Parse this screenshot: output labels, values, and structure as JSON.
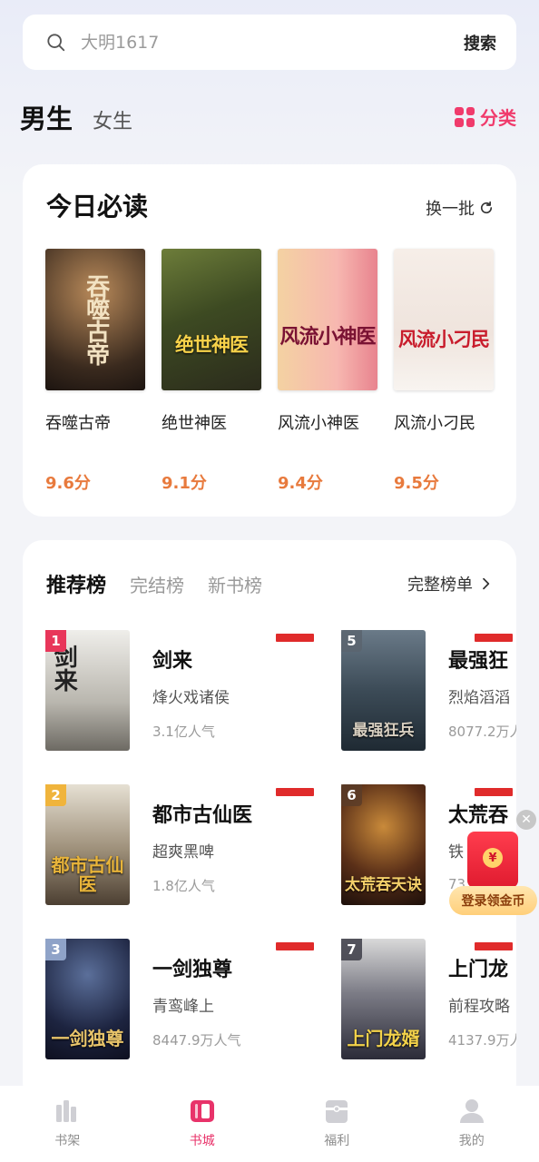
{
  "search": {
    "placeholder": "大明1617",
    "button": "搜索"
  },
  "gender": {
    "active": "男生",
    "inactive": "女生"
  },
  "category": {
    "label": "分类"
  },
  "daily": {
    "title": "今日必读",
    "refresh": "换一批",
    "books": [
      {
        "name": "吞噬古帝",
        "score": "9.6分",
        "cover_text": "吞噬古帝"
      },
      {
        "name": "绝世神医",
        "score": "9.1分",
        "cover_text": "绝世神医"
      },
      {
        "name": "风流小神医",
        "score": "9.4分",
        "cover_text": "风流小神医"
      },
      {
        "name": "风流小刁民",
        "score": "9.5分",
        "cover_text": "风流小刁民"
      }
    ]
  },
  "rank": {
    "tab_active": "推荐榜",
    "tab_2": "完结榜",
    "tab_3": "新书榜",
    "more": "完整榜单",
    "items": [
      {
        "rank": "1",
        "name": "剑来",
        "author": "烽火戏诸侯",
        "popularity": "3.1亿人气",
        "cover_text": "剑来"
      },
      {
        "rank": "2",
        "name": "都市古仙医",
        "author": "超爽黑啤",
        "popularity": "1.8亿人气",
        "cover_text": "都市古仙医"
      },
      {
        "rank": "3",
        "name": "一剑独尊",
        "author": "青鸾峰上",
        "popularity": "8447.9万人气",
        "cover_text": "一剑独尊"
      },
      {
        "rank": "5",
        "name": "最强狂",
        "author": "烈焰滔滔",
        "popularity": "8077.2万人",
        "cover_text": "最强狂兵"
      },
      {
        "rank": "6",
        "name": "太荒吞",
        "author": "铁",
        "popularity": "73",
        "cover_text": "太荒吞天诀"
      },
      {
        "rank": "7",
        "name": "上门龙",
        "author": "前程攻略",
        "popularity": "4137.9万人",
        "cover_text": "上门龙婿"
      }
    ]
  },
  "promo": {
    "label": "登录领金币",
    "coin": "¥"
  },
  "nav": {
    "items": [
      {
        "label": "书架"
      },
      {
        "label": "书城"
      },
      {
        "label": "福利"
      },
      {
        "label": "我的"
      }
    ]
  },
  "colors": {
    "accent": "#e8336a",
    "score": "#e87a3d",
    "brand_red": "#e02b2b"
  }
}
